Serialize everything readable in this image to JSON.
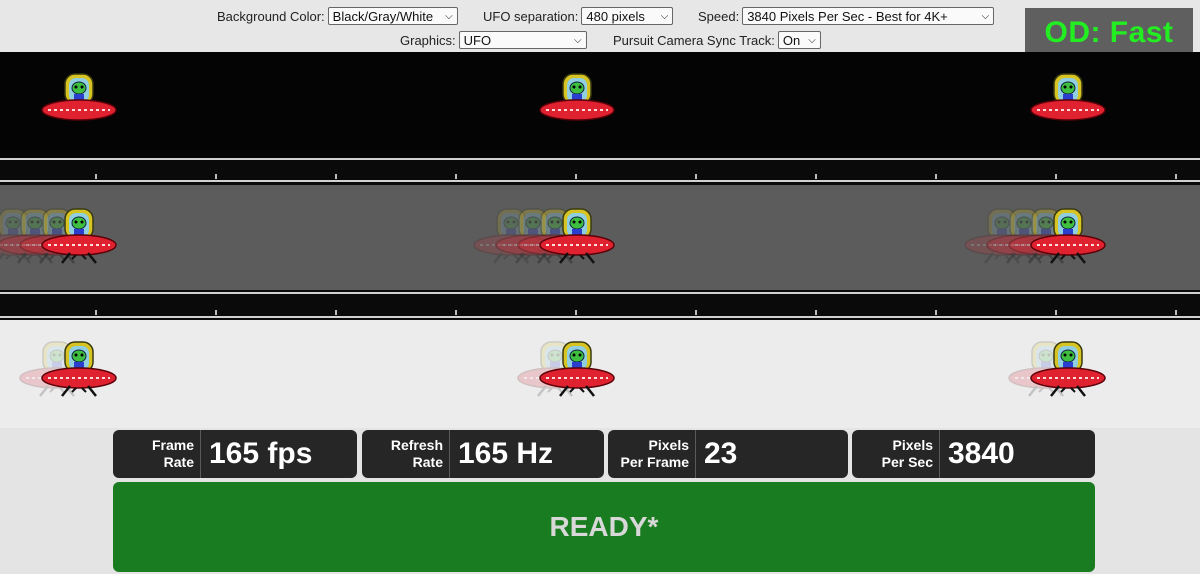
{
  "controls": {
    "background_color": {
      "label": "Background Color:",
      "value": "Black/Gray/White"
    },
    "ufo_separation": {
      "label": "UFO separation:",
      "value": "480 pixels"
    },
    "speed": {
      "label": "Speed:",
      "value": "3840 Pixels Per Sec - Best for 4K+"
    },
    "graphics": {
      "label": "Graphics:",
      "value": "UFO"
    },
    "pursuit_camera": {
      "label": "Pursuit Camera Sync Track:",
      "value": "On"
    }
  },
  "od_badge": "OD: Fast",
  "lanes": [
    {
      "name": "black",
      "color": "#040404"
    },
    {
      "name": "gray",
      "color": "#5c5c5c"
    },
    {
      "name": "white",
      "color": "#ececec"
    }
  ],
  "stats": [
    {
      "label_line1": "Frame",
      "label_line2": "Rate",
      "value": "165 fps"
    },
    {
      "label_line1": "Refresh",
      "label_line2": "Rate",
      "value": "165 Hz"
    },
    {
      "label_line1": "Pixels",
      "label_line2": "Per Frame",
      "value": "23"
    },
    {
      "label_line1": "Pixels",
      "label_line2": "Per Sec",
      "value": "3840"
    }
  ],
  "status": "READY*",
  "colors": {
    "od_text": "#22ee22",
    "ready_bg": "#1a7c20",
    "stat_bg": "#262626"
  },
  "icons": [
    "ufo-icon",
    "chevron-down-icon"
  ]
}
